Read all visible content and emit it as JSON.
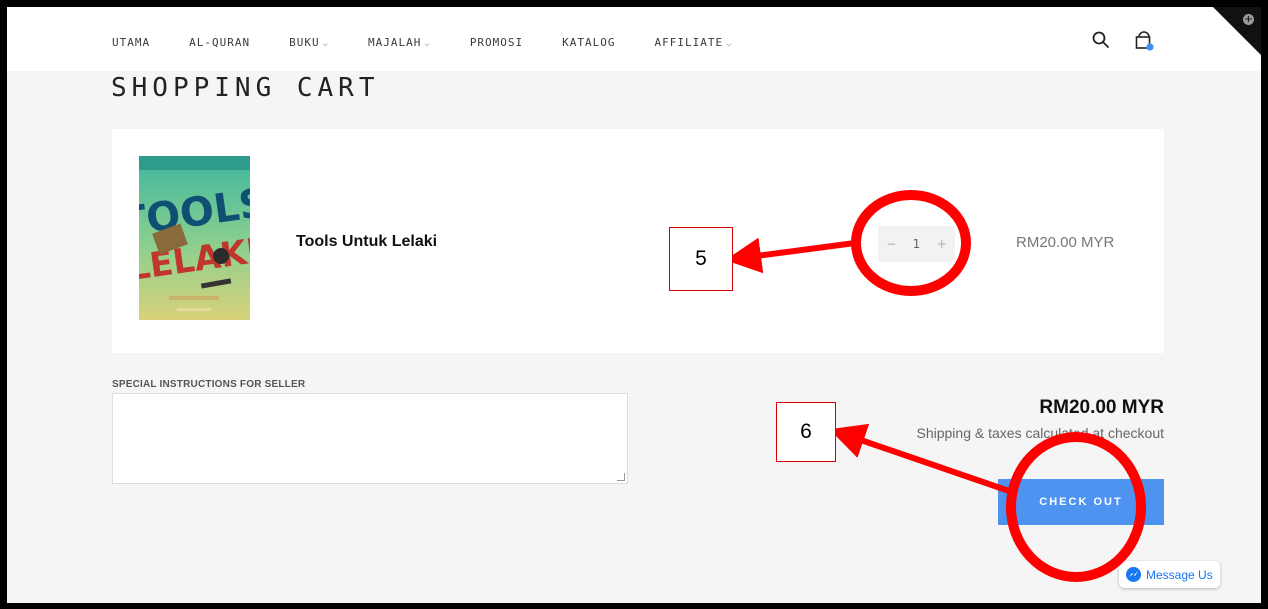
{
  "nav": {
    "items": [
      {
        "label": "UTAMA",
        "has_dropdown": false
      },
      {
        "label": "AL-QURAN",
        "has_dropdown": false
      },
      {
        "label": "BUKU",
        "has_dropdown": true
      },
      {
        "label": "MAJALAH",
        "has_dropdown": true
      },
      {
        "label": "PROMOSI",
        "has_dropdown": false
      },
      {
        "label": "KATALOG",
        "has_dropdown": false
      },
      {
        "label": "AFFILIATE",
        "has_dropdown": true
      }
    ],
    "search_icon": "search-icon",
    "cart_icon": "shopping-bag-icon"
  },
  "page_title": "SHOPPING CART",
  "cart": {
    "item": {
      "name": "Tools Untuk Lelaki",
      "quantity": "1",
      "decrement": "−",
      "increment": "+",
      "price": "RM20.00 MYR"
    }
  },
  "instructions": {
    "label": "SPECIAL INSTRUCTIONS FOR SELLER",
    "value": ""
  },
  "summary": {
    "subtotal": "RM20.00 MYR",
    "shipping_note": "Shipping & taxes calculated at checkout",
    "checkout_label": "CHECK OUT"
  },
  "messenger": {
    "label": "Message Us"
  },
  "annotations": [
    {
      "label": "5"
    },
    {
      "label": "6"
    }
  ],
  "colors": {
    "accent": "#4e93f0",
    "annotation": "#ff0000",
    "page_bg": "#f5f5f5"
  }
}
